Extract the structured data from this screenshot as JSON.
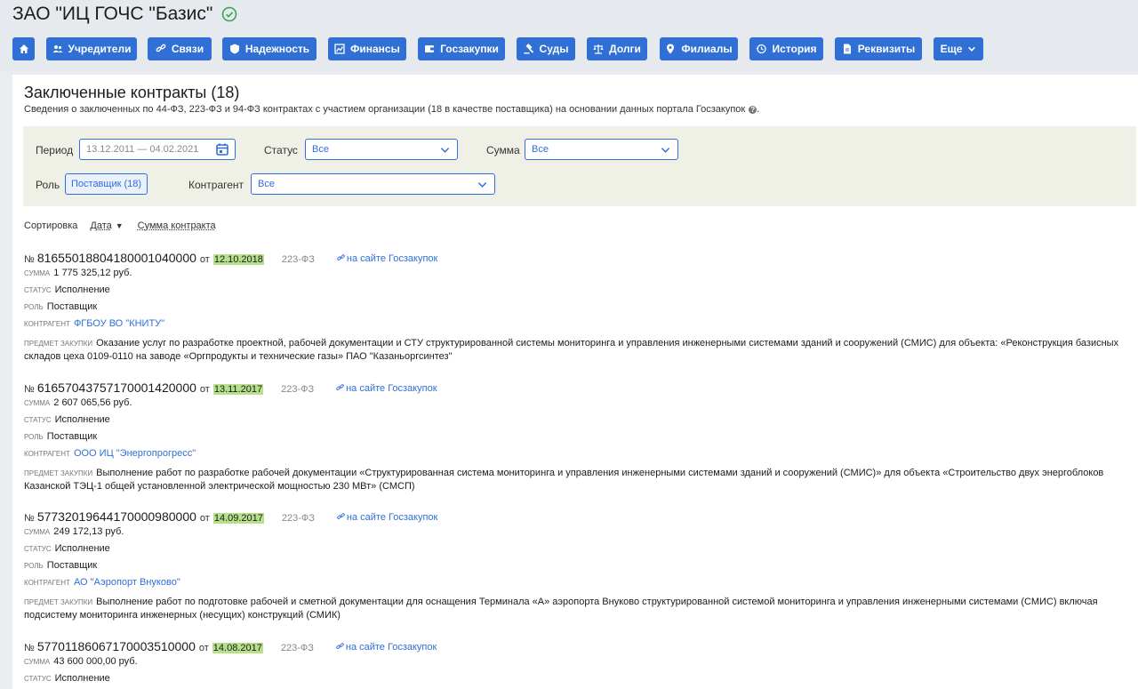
{
  "company": {
    "name": "ЗАО \"ИЦ ГОЧС \"Базис\""
  },
  "nav": [
    {
      "label": "",
      "icon": "home-icon"
    },
    {
      "label": "Учредители",
      "icon": "users-icon"
    },
    {
      "label": "Связи",
      "icon": "link-icon"
    },
    {
      "label": "Надежность",
      "icon": "shield-icon"
    },
    {
      "label": "Финансы",
      "icon": "chart-icon"
    },
    {
      "label": "Госзакупки",
      "icon": "wallet-icon"
    },
    {
      "label": "Суды",
      "icon": "gavel-icon"
    },
    {
      "label": "Долги",
      "icon": "scales-icon"
    },
    {
      "label": "Филиалы",
      "icon": "pin-icon"
    },
    {
      "label": "История",
      "icon": "history-icon"
    },
    {
      "label": "Реквизиты",
      "icon": "document-icon"
    },
    {
      "label": "Еще",
      "icon": "chevron-down-icon"
    }
  ],
  "main": {
    "title": "Заключенные контракты (18)",
    "subtitle": "Сведения о заключенных по 44-ФЗ, 223-ФЗ и 94-ФЗ контрактах с участием организации (18 в качестве поставщика) на основании данных портала Госзакупок"
  },
  "filters": {
    "period_label": "Период",
    "period_value": "13.12.2011 — 04.02.2021",
    "status_label": "Статус",
    "status_value": "Все",
    "sum_label": "Сумма",
    "sum_value": "Все",
    "role_label": "Роль",
    "role_value": "Поставщик (18)",
    "counterparty_label": "Контрагент",
    "counterparty_value": "Все"
  },
  "sort": {
    "label": "Сортировка",
    "by_date": "Дата",
    "by_sum": "Сумма контракта"
  },
  "labels": {
    "no": "№",
    "from": "от",
    "link": "на сайте Госзакупок",
    "sum": "сумма",
    "status": "статус",
    "role": "роль",
    "party": "контрагент",
    "subject": "предмет закупки"
  },
  "contracts": [
    {
      "number": "81655018804180001040000",
      "date": "12.10.2018",
      "law": "223-ФЗ",
      "sum": "1 775 325,12 руб.",
      "status": "Исполнение",
      "role": "Поставщик",
      "party": "ФГБОУ ВО \"КНИТУ\"",
      "subject": "Оказание услуг по разработке проектной, рабочей документации и СТУ структурированной системы мониторинга и управления инженерными системами зданий и сооружений (СМИС) для объекта: «Реконструкция базисных складов цеха 0109-0110 на заводе «Оргпродукты и технические газы» ПАО \"Казаньоргсинтез\""
    },
    {
      "number": "61657043757170001420000",
      "date": "13.11.2017",
      "law": "223-ФЗ",
      "sum": "2 607 065,56 руб.",
      "status": "Исполнение",
      "role": "Поставщик",
      "party": "ООО ИЦ \"Энергопрогресс\"",
      "subject": "Выполнение работ по разработке рабочей документации «Структурированная система мониторинга и управления инженерными системами зданий и сооружений (СМИС)» для объекта «Строительство двух энергоблоков Казанской ТЭЦ-1 общей установленной электрической мощностью 230 МВт» (СМСП)"
    },
    {
      "number": "57732019644170000980000",
      "date": "14.09.2017",
      "law": "223-ФЗ",
      "sum": "249 172,13 руб.",
      "status": "Исполнение",
      "role": "Поставщик",
      "party": "АО \"Аэропорт Внуково\"",
      "subject": "Выполнение работ по подготовке рабочей и сметной документации для оснащения Терминала «А» аэропорта Внуково структурированной системой мониторинга и управления инженерными системами (СМИС) включая подсистему мониторинга инженерных (несущих) конструкций (СМИК)"
    },
    {
      "number": "57701186067170003510000",
      "date": "14.08.2017",
      "law": "223-ФЗ",
      "sum": "43 600 000,00 руб.",
      "status": "Исполнение"
    }
  ],
  "colors": {
    "accent": "#2f6fd6",
    "date_highlight": "#b6e08a",
    "filter_bg": "#f0f1e6"
  }
}
